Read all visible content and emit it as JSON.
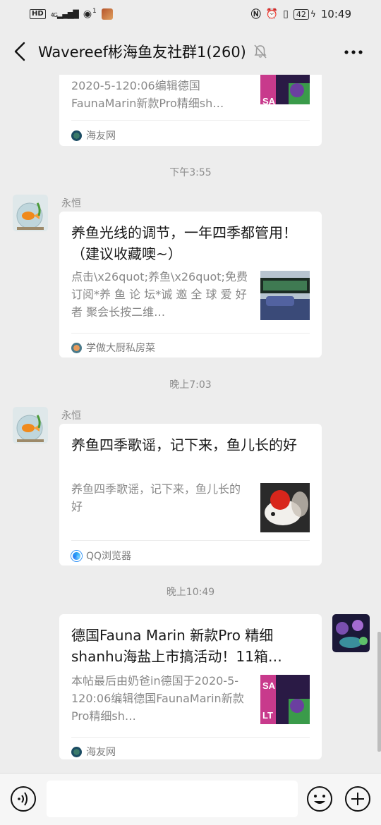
{
  "status_bar": {
    "hd": "HD",
    "net": "4G",
    "notif_count": "1",
    "battery": "42",
    "time": "10:49"
  },
  "nav": {
    "title": "Wavereef彬海鱼友社群1(260)"
  },
  "messages": [
    {
      "type": "link_card_partial",
      "desc": "2020-5-120:06编辑德国FaunaMarin新款Pro精细sh…",
      "source": "海友网"
    },
    {
      "type": "time",
      "text": "下午3:55"
    },
    {
      "type": "link_card",
      "sender": "永恒",
      "title": "养鱼光线的调节，一年四季都管用！（建议收藏噢~）",
      "desc": "点击\\x26quot;养鱼\\x26quot;免费订阅*养 鱼 论 坛*诚 邀 全 球 爱 好 者 聚会长按二维…",
      "source": "学做大厨私房菜"
    },
    {
      "type": "time",
      "text": "晚上7:03"
    },
    {
      "type": "link_card",
      "sender": "永恒",
      "title": "养鱼四季歌谣，记下来，鱼儿长的好",
      "desc": "养鱼四季歌谣，记下来，鱼儿长的好",
      "source": "QQ浏览器"
    },
    {
      "type": "time",
      "text": "晚上10:49"
    },
    {
      "type": "link_card_self",
      "title": "德国Fauna Marin 新款Pro 精细shanhu海盐上市搞活动！11箱…",
      "desc": "本帖最后由奶爸in德国于2020-5-120:06编辑德国FaunaMarin新款Pro精细sh…",
      "source": "海友网"
    }
  ],
  "colors": {
    "background": "#ededed",
    "card": "#ffffff",
    "muted_text": "#888888"
  }
}
